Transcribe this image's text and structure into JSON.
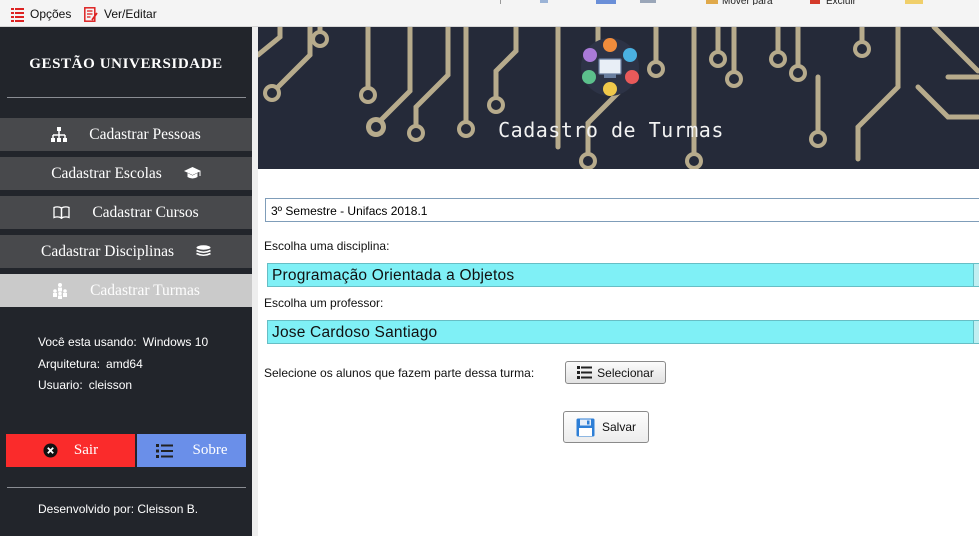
{
  "menu": {
    "options_label": "Opções",
    "view_edit_label": "Ver/Editar",
    "strip_move_label": "Mover para",
    "strip_delete_label": "Excluir"
  },
  "sidebar": {
    "brand": "GESTÃO UNIVERSIDADE",
    "items": [
      {
        "label": "Cadastrar Pessoas",
        "icon": "sitemap-icon"
      },
      {
        "label": "Cadastrar Escolas",
        "icon": "graduation-cap-icon"
      },
      {
        "label": "Cadastrar Cursos",
        "icon": "book-icon"
      },
      {
        "label": "Cadastrar Disciplinas",
        "icon": "stack-icon"
      },
      {
        "label": "Cadastrar Turmas",
        "icon": "group-icon"
      }
    ],
    "active_item": "Cadastrar Turmas",
    "system_info": {
      "os_label": "Você esta usando:",
      "os_value": "Windows 10",
      "arch_label": "Arquitetura:",
      "arch_value": "amd64",
      "user_label": "Usuario:",
      "user_value": "cleisson"
    },
    "sair_label": "Sair",
    "sobre_label": "Sobre",
    "footer": "Desenvolvido por: Cleisson B."
  },
  "main": {
    "banner_title": "Cadastro de Turmas",
    "turma_name": "3º Semestre - Unifacs 2018.1",
    "disciplina_label": "Escolha uma disciplina:",
    "disciplina_value": "Programação Orientada a Objetos",
    "professor_label": "Escolha um professor:",
    "professor_value": "Jose Cardoso Santiago",
    "alunos_label": "Selecione os alunos que fazem parte dessa turma:",
    "selecionar_label": "Selecionar",
    "salvar_label": "Salvar"
  },
  "colors": {
    "sidebar_bg": "#22252b",
    "nav_bg": "#48494c",
    "nav_active_bg": "#cacaca",
    "sair_bg": "#fa2b2b",
    "sobre_bg": "#6a8fe9",
    "banner_bg": "#252a39",
    "circuit": "#b7ab8c",
    "combo_bg": "#7ff0f6"
  }
}
